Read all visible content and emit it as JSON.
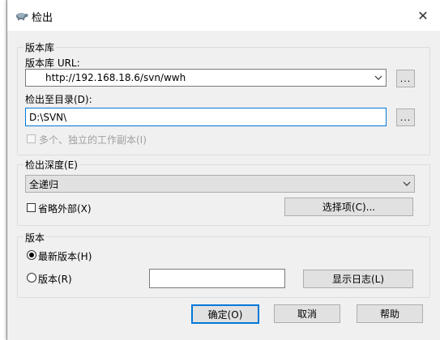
{
  "window": {
    "title": "检出",
    "close_glyph": "✕"
  },
  "repository": {
    "group_label": "版本库",
    "url_label": "版本库 URL:",
    "url_value": "http://192.168.18.6/svn/wwh",
    "browse_label": "...",
    "checkout_dir_label": "检出至目录(D):",
    "checkout_dir_value": "D:\\SVN\\",
    "browse_dir_label": "...",
    "multi_label": "多个、独立的工作副本(I)"
  },
  "depth": {
    "group_label": "检出深度(E)",
    "selected": "全递归",
    "omit_externals_label": "省略外部(X)",
    "options_button": "选择项(C)..."
  },
  "revision": {
    "group_label": "版本",
    "head_label": "最新版本(H)",
    "revision_label": "版本(R)",
    "revision_value": "",
    "show_log_button": "显示日志(L)"
  },
  "footer": {
    "ok_label": "确定(O)",
    "cancel_label": "取消",
    "help_label": "帮助"
  },
  "colors": {
    "accent": "#0078d7",
    "button_bg": "#e1e1e1"
  }
}
